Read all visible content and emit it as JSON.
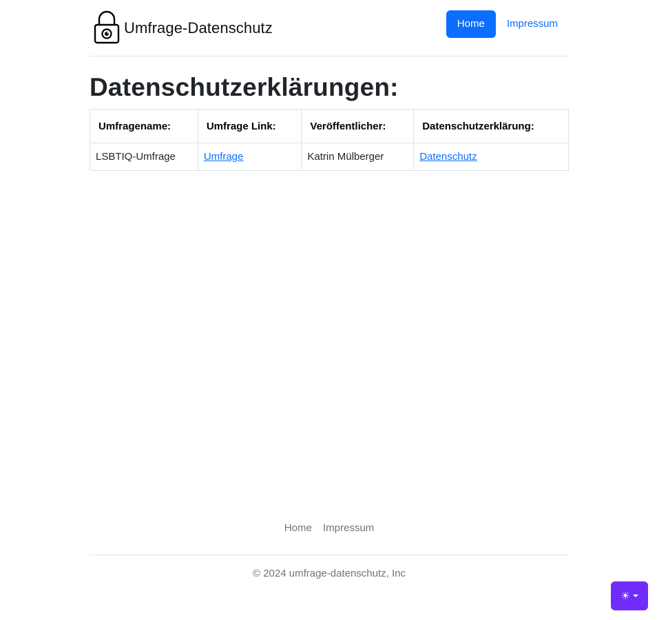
{
  "header": {
    "brand_name": "Umfrage-Datenschutz",
    "nav": {
      "home_label": "Home",
      "impressum_label": "Impressum"
    }
  },
  "main": {
    "title": "Datenschutzerklärungen:",
    "table": {
      "headers": [
        "Umfragename:",
        "Umfrage Link:",
        "Veröffentlicher:",
        "Datenschutzerklärung:"
      ],
      "rows": [
        {
          "name": "LSBTIQ-Umfrage",
          "link_label": "Umfrage",
          "publisher": "Katrin Mülberger",
          "privacy_label": "Datenschutz"
        }
      ]
    }
  },
  "footer": {
    "nav": {
      "home_label": "Home",
      "impressum_label": "Impressum"
    },
    "copyright": "© 2024 umfrage-datenschutz, Inc"
  },
  "theme_toggle": {
    "icon": "sun-icon",
    "accent": "#712cf9"
  },
  "colors": {
    "primary": "#0d6efd",
    "muted": "#6c757d",
    "border": "#dee2e6"
  }
}
